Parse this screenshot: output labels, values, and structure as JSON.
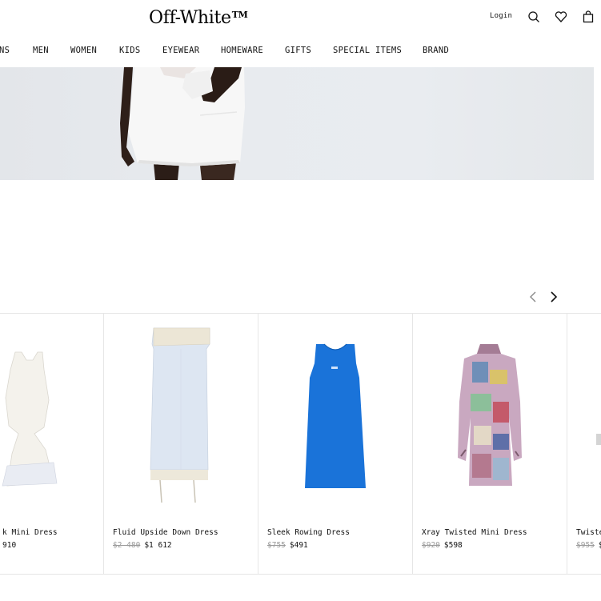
{
  "header": {
    "logo": "Off-White",
    "logo_tm": "TM",
    "login": "Login",
    "icons": [
      "search-icon",
      "heart-icon",
      "bag-icon"
    ]
  },
  "nav": [
    "NS",
    "MEN",
    "WOMEN",
    "KIDS",
    "EYEWEAR",
    "HOMEWARE",
    "GIFTS",
    "SPECIAL ITEMS",
    "BRAND"
  ],
  "carousel": {
    "prev_icon": "chevron-left-icon",
    "next_icon": "chevron-right-icon"
  },
  "products": [
    {
      "name": "k Mini Dress",
      "old_price": "",
      "price": "910"
    },
    {
      "name": "Fluid Upside Down Dress",
      "old_price": "$2 480",
      "price": "$1 612"
    },
    {
      "name": "Sleek Rowing Dress",
      "old_price": "$755",
      "price": "$491"
    },
    {
      "name": "Xray Twisted Mini Dress",
      "old_price": "$920",
      "price": "$598"
    },
    {
      "name": "Twiste",
      "old_price": "$955",
      "price": "$"
    }
  ],
  "colors": {
    "accent_blue": "#1a73d9",
    "sale_grey": "#9a9a9a"
  }
}
